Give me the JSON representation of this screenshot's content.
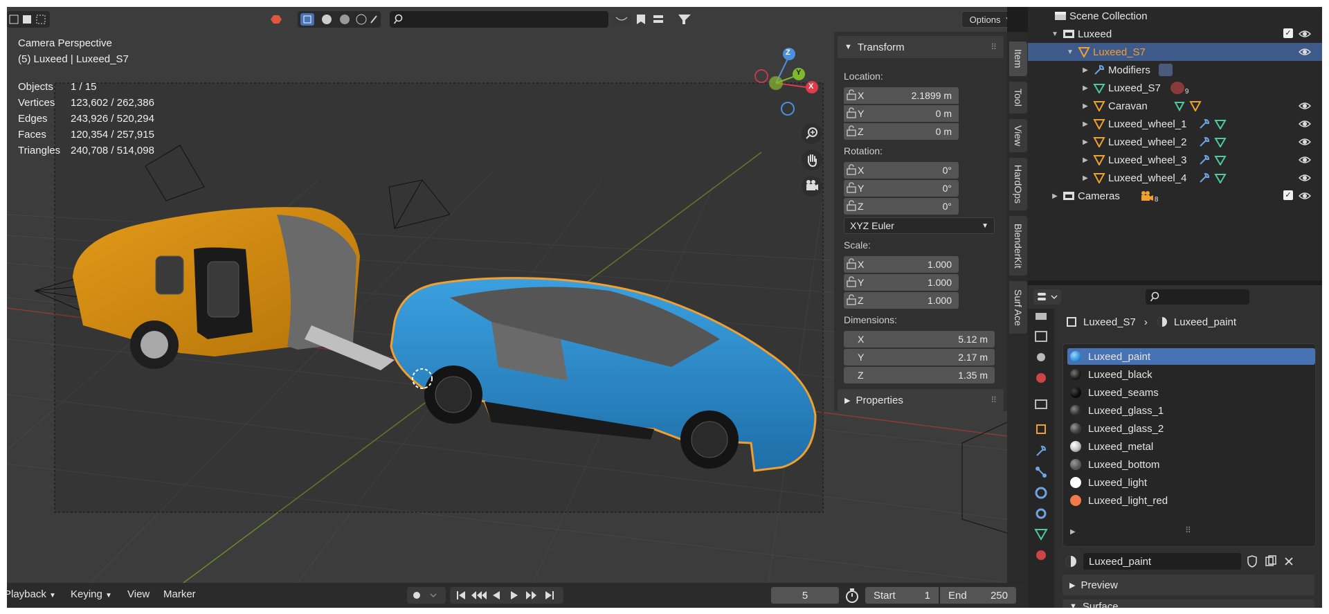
{
  "viewport": {
    "view_name": "Camera Perspective",
    "context": "(5) Luxeed | Luxeed_S7",
    "stats": [
      {
        "label": "Objects",
        "value": "1 / 15"
      },
      {
        "label": "Vertices",
        "value": "123,602 / 262,386"
      },
      {
        "label": "Edges",
        "value": "243,926 / 520,294"
      },
      {
        "label": "Faces",
        "value": "120,354 / 257,915"
      },
      {
        "label": "Triangles",
        "value": "240,708 / 514,098"
      }
    ],
    "options_label": "Options",
    "gizmo": {
      "x": "X",
      "y": "Y",
      "z": "Z"
    }
  },
  "npanel": {
    "transform_label": "Transform",
    "location_label": "Location:",
    "location": [
      {
        "axis": "X",
        "value": "2.1899 m"
      },
      {
        "axis": "Y",
        "value": "0 m"
      },
      {
        "axis": "Z",
        "value": "0 m"
      }
    ],
    "rotation_label": "Rotation:",
    "rotation": [
      {
        "axis": "X",
        "value": "0°"
      },
      {
        "axis": "Y",
        "value": "0°"
      },
      {
        "axis": "Z",
        "value": "0°"
      }
    ],
    "rotation_mode": "XYZ Euler",
    "scale_label": "Scale:",
    "scale": [
      {
        "axis": "X",
        "value": "1.000"
      },
      {
        "axis": "Y",
        "value": "1.000"
      },
      {
        "axis": "Z",
        "value": "1.000"
      }
    ],
    "dimensions_label": "Dimensions:",
    "dimensions": [
      {
        "axis": "X",
        "value": "5.12 m"
      },
      {
        "axis": "Y",
        "value": "2.17 m"
      },
      {
        "axis": "Z",
        "value": "1.35 m"
      }
    ],
    "properties_label": "Properties"
  },
  "vtabs": [
    "Item",
    "Tool",
    "View",
    "HardOps",
    "BlenderKit",
    "Surf Ace"
  ],
  "outliner": {
    "root": "Scene Collection",
    "rows": [
      {
        "name": "Luxeed",
        "indent": 1,
        "type": "collection"
      },
      {
        "name": "Luxeed_S7",
        "indent": 2,
        "type": "object"
      },
      {
        "name": "Modifiers",
        "indent": 3,
        "type": "modifier"
      },
      {
        "name": "Luxeed_S7",
        "indent": 3,
        "type": "mesh",
        "badge": "9"
      },
      {
        "name": "Caravan",
        "indent": 3,
        "type": "object"
      },
      {
        "name": "Luxeed_wheel_1",
        "indent": 3,
        "type": "object"
      },
      {
        "name": "Luxeed_wheel_2",
        "indent": 3,
        "type": "object"
      },
      {
        "name": "Luxeed_wheel_3",
        "indent": 3,
        "type": "object"
      },
      {
        "name": "Luxeed_wheel_4",
        "indent": 3,
        "type": "object"
      },
      {
        "name": "Cameras",
        "indent": 1,
        "type": "collection",
        "badge": "8"
      }
    ]
  },
  "properties": {
    "breadcrumb_object": "Luxeed_S7",
    "breadcrumb_material": "Luxeed_paint",
    "materials": [
      {
        "name": "Luxeed_paint",
        "color": "#2d8fd6"
      },
      {
        "name": "Luxeed_black",
        "color": "#1a1a1a"
      },
      {
        "name": "Luxeed_seams",
        "color": "#0a0a0a"
      },
      {
        "name": "Luxeed_glass_1",
        "color": "#2c2c2c"
      },
      {
        "name": "Luxeed_glass_2",
        "color": "#3a3a3a"
      },
      {
        "name": "Luxeed_metal",
        "color": "#c8c8c8"
      },
      {
        "name": "Luxeed_bottom",
        "color": "#555555"
      },
      {
        "name": "Luxeed_light",
        "color": "#ffffff"
      },
      {
        "name": "Luxeed_light_red",
        "color": "#f07a4a"
      }
    ],
    "active_material": "Luxeed_paint",
    "preview_label": "Preview",
    "surface_label": "Surface"
  },
  "timeline": {
    "playback": "Playback",
    "keying": "Keying",
    "view": "View",
    "marker": "Marker",
    "current_frame": "5",
    "start_label": "Start",
    "start": "1",
    "end_label": "End",
    "end": "250"
  },
  "colors": {
    "selection_orange": "#f0a030",
    "accent_blue": "#4772b3",
    "car_blue": "#2b86c8",
    "caravan_orange": "#d08a12"
  }
}
